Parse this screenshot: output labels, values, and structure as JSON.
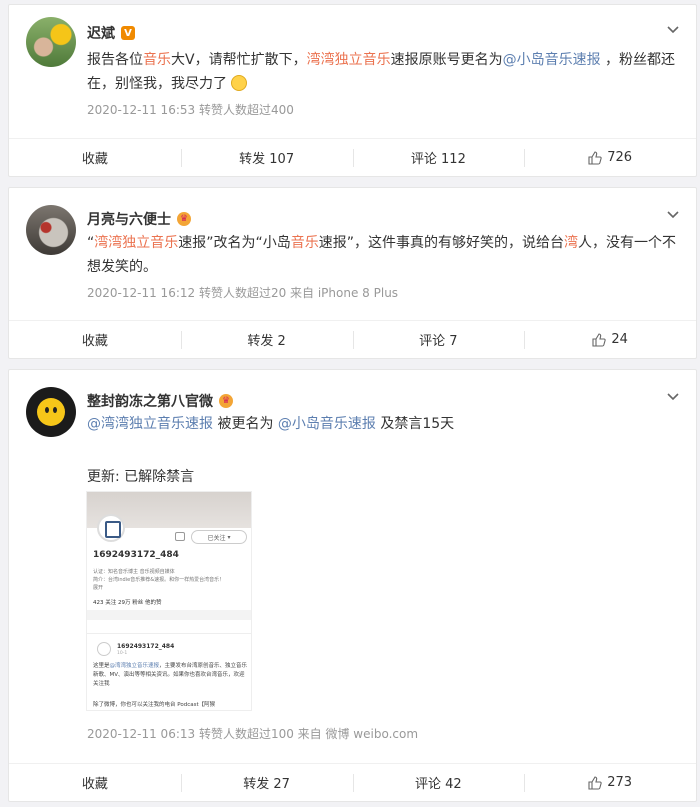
{
  "posts": [
    {
      "author": "迟斌",
      "text_segments": [
        {
          "t": "报告各位",
          "c": "plain"
        },
        {
          "t": "音乐",
          "c": "hl"
        },
        {
          "t": "大V，请帮忙扩散下，",
          "c": "plain"
        },
        {
          "t": "湾湾独立音乐",
          "c": "hl"
        },
        {
          "t": "速报原账号更名为",
          "c": "plain"
        },
        {
          "t": "@小岛音乐速报",
          "c": "lk"
        },
        {
          "t": " ，粉丝都还在，别怪我，我尽力了",
          "c": "plain"
        }
      ],
      "meta": "2020-12-11 16:53 转赞人数超过400",
      "actions": {
        "collect": "收藏",
        "repost": "转发 107",
        "comment": "评论 112",
        "like": "726"
      }
    },
    {
      "author": "月亮与六便士",
      "text_segments": [
        {
          "t": "“",
          "c": "plain"
        },
        {
          "t": "湾湾独立音乐",
          "c": "hl"
        },
        {
          "t": "速报”改名为“小岛",
          "c": "plain"
        },
        {
          "t": "音乐",
          "c": "hl"
        },
        {
          "t": "速报”，这件事真的有够好笑的，说给台",
          "c": "plain"
        },
        {
          "t": "湾",
          "c": "hl"
        },
        {
          "t": "人，没有一个不想发笑的。",
          "c": "plain"
        }
      ],
      "meta": "2020-12-11 16:12 转赞人数超过20 来自 iPhone 8 Plus",
      "actions": {
        "collect": "收藏",
        "repost": "转发 2",
        "comment": "评论 7",
        "like": "24"
      }
    },
    {
      "author": "整封韵冻之第八官微",
      "link1": "@湾湾独立音乐速报",
      "mid": " 被更名为 ",
      "link2": "@小岛音乐速报",
      "tail": " 及禁言15天",
      "update": "更新: 已解除禁言",
      "meta": "2020-12-11 06:13 转赞人数超过100 来自 微博 weibo.com",
      "actions": {
        "collect": "收藏",
        "repost": "转发 27",
        "comment": "评论 42",
        "like": "273"
      }
    }
  ],
  "screenshot": {
    "follow_label": "已关注",
    "name": "1692493172_484",
    "line1": "认证：知名音乐博主 音乐视频自媒体",
    "line2": "简介：台湾indie音乐推荐&速报。和你一样热爱台湾音乐！",
    "line3": "展开",
    "stats": "423 关注    29万 粉丝    他的赞",
    "post_name": "1692493172_484",
    "post_date": "10-1",
    "body_pre": "这里是",
    "body_link": "@湾湾独立音乐速报",
    "body_rest": "，主要发布台湾原创音乐、独立音乐新歌、MV、演出等等相关资讯。如果你也喜欢台湾音乐，欢迎关注我",
    "footer": "除了微博，你也可以关注我的电台 Podcast【阿猴"
  }
}
